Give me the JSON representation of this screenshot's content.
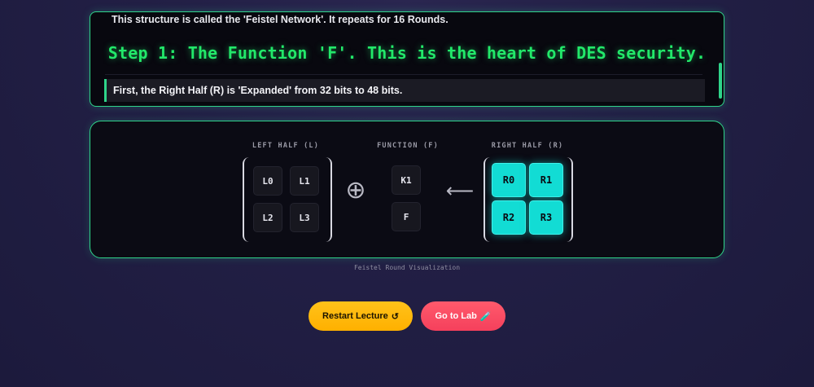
{
  "lecture": {
    "previous_line": "This structure is called the 'Feistel Network'. It repeats for 16 Rounds.",
    "step_title": "Step 1: The Function 'F'. This is the heart of DES security.",
    "current_line": "First, the Right Half (R) is 'Expanded' from 32 bits to 48 bits."
  },
  "visualization": {
    "left": {
      "label": "LEFT HALF (L)",
      "cells": [
        "L0",
        "L1",
        "L2",
        "L3"
      ]
    },
    "function": {
      "label": "FUNCTION (F)",
      "cells": [
        "K1",
        "F"
      ]
    },
    "right": {
      "label": "RIGHT HALF (R)",
      "cells": [
        "R0",
        "R1",
        "R2",
        "R3"
      ]
    },
    "xor_symbol": "⊕",
    "arrow_symbol": "⟵",
    "caption": "Feistel Round Visualization"
  },
  "buttons": {
    "restart": {
      "label": "Restart Lecture",
      "icon": "↺"
    },
    "lab": {
      "label": "Go to Lab",
      "icon": "🧪"
    }
  },
  "colors": {
    "accent": "#2fd48a",
    "title": "#22e86a",
    "active_cell": "#12dcd4",
    "restart": "#ffb800",
    "lab": "#f5405c"
  }
}
